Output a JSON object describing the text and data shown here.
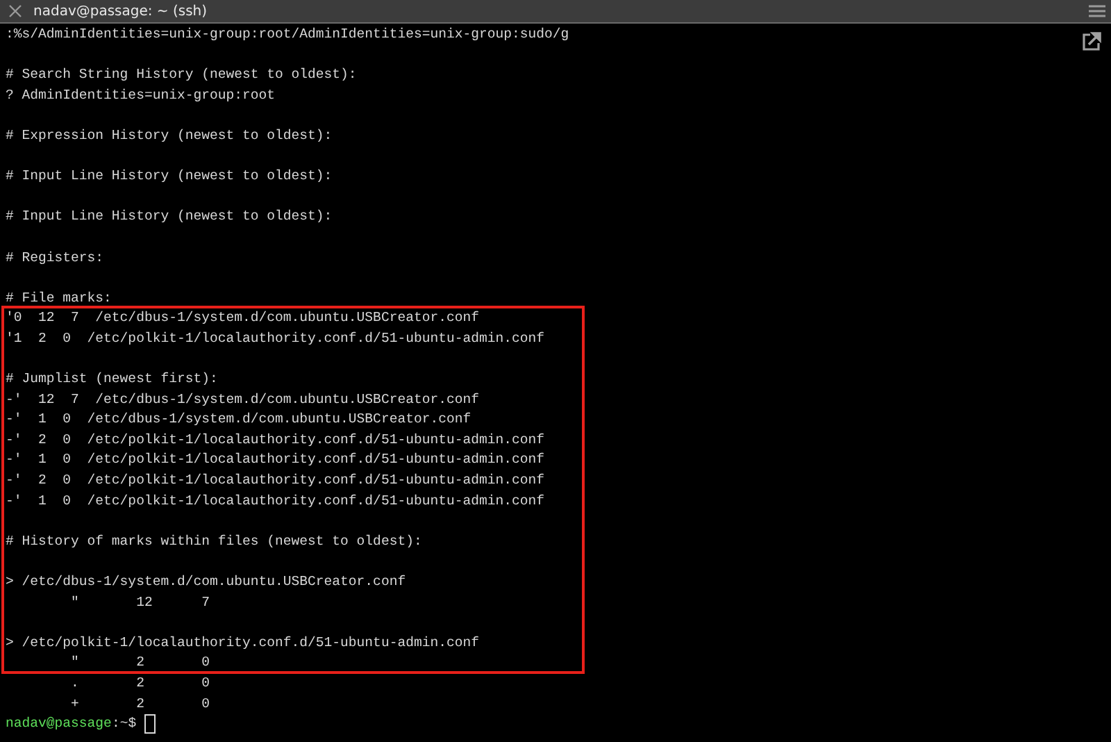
{
  "window": {
    "title": "nadav@passage: ~ (ssh)"
  },
  "terminal": {
    "lines": [
      {
        "kind": "output",
        "text": ":%s/AdminIdentities=unix-group:root/AdminIdentities=unix-group:sudo/g"
      },
      {
        "kind": "blank"
      },
      {
        "kind": "output",
        "text": "# Search String History (newest to oldest):"
      },
      {
        "kind": "output",
        "text": "? AdminIdentities=unix-group:root"
      },
      {
        "kind": "blank"
      },
      {
        "kind": "output",
        "text": "# Expression History (newest to oldest):"
      },
      {
        "kind": "blank"
      },
      {
        "kind": "output",
        "text": "# Input Line History (newest to oldest):"
      },
      {
        "kind": "blank"
      },
      {
        "kind": "output",
        "text": "# Input Line History (newest to oldest):"
      },
      {
        "kind": "blank"
      },
      {
        "kind": "output",
        "text": "# Registers:"
      },
      {
        "kind": "blank"
      },
      {
        "kind": "output",
        "text": "# File marks:"
      },
      {
        "kind": "output",
        "text": "'0  12  7  /etc/dbus-1/system.d/com.ubuntu.USBCreator.conf"
      },
      {
        "kind": "output",
        "text": "'1  2  0  /etc/polkit-1/localauthority.conf.d/51-ubuntu-admin.conf"
      },
      {
        "kind": "blank"
      },
      {
        "kind": "output",
        "text": "# Jumplist (newest first):"
      },
      {
        "kind": "output",
        "text": "-'  12  7  /etc/dbus-1/system.d/com.ubuntu.USBCreator.conf"
      },
      {
        "kind": "output",
        "text": "-'  1  0  /etc/dbus-1/system.d/com.ubuntu.USBCreator.conf"
      },
      {
        "kind": "output",
        "text": "-'  2  0  /etc/polkit-1/localauthority.conf.d/51-ubuntu-admin.conf"
      },
      {
        "kind": "output",
        "text": "-'  1  0  /etc/polkit-1/localauthority.conf.d/51-ubuntu-admin.conf"
      },
      {
        "kind": "output",
        "text": "-'  2  0  /etc/polkit-1/localauthority.conf.d/51-ubuntu-admin.conf"
      },
      {
        "kind": "output",
        "text": "-'  1  0  /etc/polkit-1/localauthority.conf.d/51-ubuntu-admin.conf"
      },
      {
        "kind": "blank"
      },
      {
        "kind": "output",
        "text": "# History of marks within files (newest to oldest):"
      },
      {
        "kind": "blank"
      },
      {
        "kind": "output",
        "text": "> /etc/dbus-1/system.d/com.ubuntu.USBCreator.conf"
      },
      {
        "kind": "output",
        "text": "        \"       12      7"
      },
      {
        "kind": "blank"
      },
      {
        "kind": "output",
        "text": "> /etc/polkit-1/localauthority.conf.d/51-ubuntu-admin.conf"
      },
      {
        "kind": "output",
        "text": "        \"       2       0"
      },
      {
        "kind": "output",
        "text": "        .       2       0"
      },
      {
        "kind": "output",
        "text": "        +       2       0"
      }
    ],
    "prompt": {
      "user_host": "nadav@passage",
      "path": ":~$"
    }
  }
}
